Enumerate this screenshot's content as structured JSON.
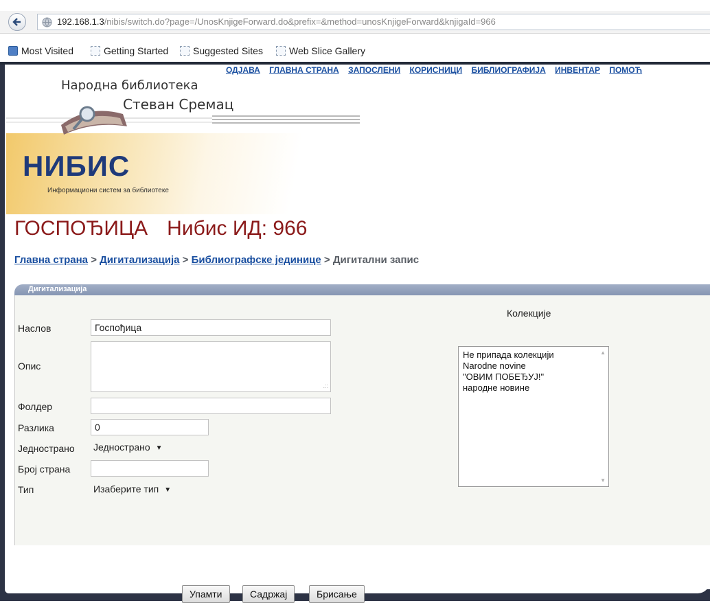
{
  "browser": {
    "url_host": "192.168.1.3",
    "url_path": "/nibis/switch.do?page=/UnosKnjigeForward.do&prefix=&method=unosKnjigeForward&knjigaId=966",
    "bookmarks": [
      "Most Visited",
      "Getting Started",
      "Suggested Sites",
      "Web Slice Gallery"
    ]
  },
  "topnav": [
    "ОДЈАВА",
    "ГЛАВНА СТРАНА",
    "ЗАПОСЛЕНИ",
    "КОРИСНИЦИ",
    "БИБЛИОГРАФИЈА",
    "ИНВЕНТАР",
    "ПОМОЋ"
  ],
  "logo": {
    "line1": "Народна библиотека",
    "line2": "Стеван Сремац",
    "brand": "НИБИС",
    "tagline": "Информациони систем за библиотеке"
  },
  "title": {
    "book": "ГОСПОЂИЦА",
    "id_label": "Нибис ИД: 966"
  },
  "breadcrumb": {
    "home": "Главна страна",
    "digital": "Дигитализација",
    "biblio": "Библиографске јединице",
    "current": "Дигитални запис",
    "sep": ">"
  },
  "panel": {
    "header": "Дигитализација",
    "fields": {
      "naslov_label": "Наслов",
      "naslov_value": "Госпођица",
      "opis_label": "Опис",
      "folder_label": "Фолдер",
      "folder_value": "",
      "razlika_label": "Разлика",
      "razlika_value": "0",
      "jednostrano_label": "Једнострано",
      "jednostrano_value": "Једнострано",
      "broj_label": "Број страна",
      "broj_value": "",
      "tip_label": "Тип",
      "tip_value": "Изаберите тип"
    },
    "collections": {
      "title": "Колекције",
      "options": [
        "Не припада колекцији",
        "Narodne novine",
        "\"ОВИМ ПОБЕЂУЈ!\"",
        "народне новине"
      ]
    },
    "buttons": {
      "save": "Упамти",
      "content": "Садржај",
      "delete": "Брисање"
    }
  }
}
